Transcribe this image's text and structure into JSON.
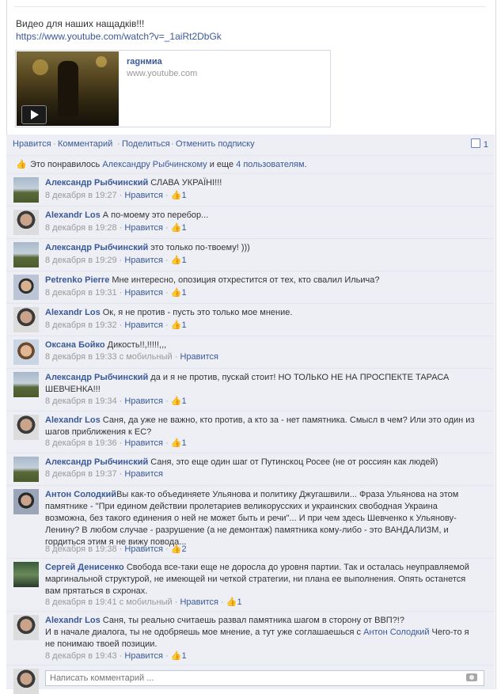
{
  "post": {
    "text": "Видео для наших нащадків!!!",
    "link": "https://www.youtube.com/watch?v=_1aiRt2DbGk",
    "attachment": {
      "title": "ragнмиа",
      "domain": "www.youtube.com"
    }
  },
  "actions": {
    "like": "Нравится",
    "comment": "Комментарий",
    "share": "Поделиться",
    "unsubscribe": "Отменить подписку",
    "comment_count": "1"
  },
  "likes_bar": {
    "prefix": "Это понравилось ",
    "person": "Александру Рыбчинскому",
    "middle": " и еще ",
    "others": "4 пользователям",
    "suffix": "."
  },
  "comments": [
    {
      "author": "Александр Рыбчинский",
      "text": "СЛАВА УКРАЇНІ!!!",
      "time": "8 декабря в 19:27",
      "like": "Нравится",
      "likes": "1",
      "mobile": ""
    },
    {
      "author": "Alexandr Los",
      "text": "А по-моему это перебор...",
      "time": "8 декабря в 19:28",
      "like": "Нравится",
      "likes": "1",
      "mobile": ""
    },
    {
      "author": "Александр Рыбчинский",
      "text": "это только по-твоему! )))",
      "time": "8 декабря в 19:29",
      "like": "Нравится",
      "likes": "1",
      "mobile": ""
    },
    {
      "author": "Petrenko Pierre",
      "text": "Мне интересно, опозиция отхрестится от тех, кто свалил Ильича?",
      "time": "8 декабря в 19:31",
      "like": "Нравится",
      "likes": "1",
      "mobile": ""
    },
    {
      "author": "Alexandr Los",
      "text": "Ок, я не против - пусть это только мое мнение.",
      "time": "8 декабря в 19:32",
      "like": "Нравится",
      "likes": "1",
      "mobile": ""
    },
    {
      "author": "Оксана Бойко",
      "text": "Дикость!!,!!!!!,,,",
      "time": "8 декабря в 19:33",
      "like": "Нравится",
      "likes": "",
      "mobile": "с мобильный"
    },
    {
      "author": "Александр Рыбчинский",
      "text": "да и я не против, пускай стоит! НО ТОЛЬКО НЕ НА ПРОСПЕКТЕ ТАРАСА ШЕВЧЕНКА!!!",
      "time": "8 декабря в 19:34",
      "like": "Нравится",
      "likes": "1",
      "mobile": ""
    },
    {
      "author": "Alexandr Los",
      "text": "Саня, да уже не важно, кто против, а кто за - нет памятника. Смысл в чем? Или это один из шагов приближения к ЕС?",
      "time": "8 декабря в 19:36",
      "like": "Нравится",
      "likes": "1",
      "mobile": ""
    },
    {
      "author": "Александр Рыбчинский",
      "text": "Саня, это еще один шаг от Путинскоц Росее (не от россиян как людей)",
      "time": "8 декабря в 19:37",
      "like": "Нравится",
      "likes": "",
      "mobile": ""
    },
    {
      "author": "Антон Солодкий",
      "text": "Вы как-то объединяете Ульянова и политику Джугашвили... Фраза Ульянова на этом памятнике - \"При едином действии пролетариев великорусских и украинских свободная Украина возможна, без такого единения о ней не может быть и речи\"... И при чем здесь Шевченко к Ульянову-Ленину? В любом случае - разрушение (а не демонтаж) памятника кому-либо - это ВАНДАЛИЗМ, и гордиться этим я не вижу повода...",
      "time": "8 декабря в 19:38",
      "like": "Нравится",
      "likes": "2",
      "mobile": ""
    },
    {
      "author": "Сергей Денисенко",
      "text": "Свобода все-таки еще не доросла до уровня партии. Так и осталась неуправляемой маргинальной структурой, не имеющей ни четкой стратегии, ни плана ее выполнения. Опять останется вам прятаться в схронах.",
      "time": "8 декабря в 19:41",
      "like": "Нравится",
      "likes": "1",
      "mobile": "с мобильный"
    },
    {
      "author": "Alexandr Los",
      "text_before": "Саня, ты реально считаешь развал памятника шагом в сторону от ВВП?!?",
      "text_line2": "И в начале диалога, ты не одобряешь мое мнение, а тут уже соглашаешься с ",
      "mention": "Антон Солодкий",
      "text_after": " Чего-то я не понимаю твоей позиции.",
      "time": "8 декабря в 19:43",
      "like": "Нравится",
      "likes": "1",
      "mobile": ""
    }
  ],
  "composer": {
    "placeholder": "Написать комментарий ..."
  },
  "colors": {
    "link": "#3b5998",
    "panel": "#edeff4",
    "border": "#e2e5ec"
  }
}
